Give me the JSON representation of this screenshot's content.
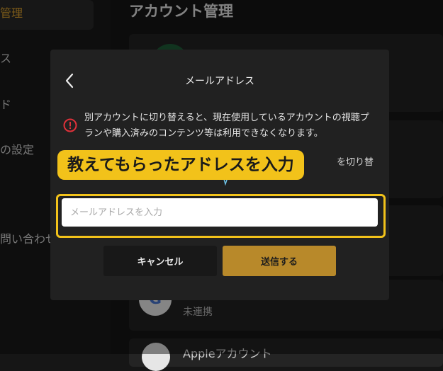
{
  "sidebar": {
    "items": [
      {
        "label": "管理",
        "active": true
      },
      {
        "label": "ス"
      },
      {
        "label": "ド"
      },
      {
        "label": "の設定"
      },
      {
        "label": "問い合わせ"
      }
    ]
  },
  "main": {
    "title": "アカウント管理",
    "google_status": "未連携",
    "apple_label": "Appleアカウント"
  },
  "modal": {
    "title": "メールアドレス",
    "warning": "別アカウントに切り替えると、現在使用しているアカウントの視聴プランや購入済みのコンテンツ等は利用できなくなります。",
    "partial_text": "を切り替",
    "input_placeholder": "メールアドレスを入力",
    "cancel_label": "キャンセル",
    "send_label": "送信する"
  },
  "annotation": {
    "callout": "教えてもらったアドレスを入力"
  },
  "colors": {
    "accent": "#f2c21a",
    "send_button": "#b8892a",
    "warning": "#e0313a",
    "sidebar_active": "#e3a72f"
  }
}
